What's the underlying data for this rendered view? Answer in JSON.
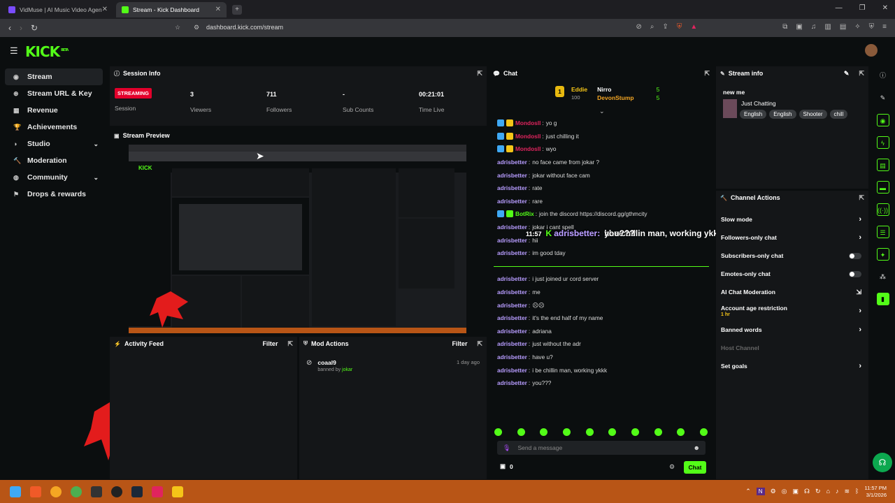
{
  "browser": {
    "tabs": [
      {
        "label": "VidMuse | AI Music Video Agent fo",
        "active": false
      },
      {
        "label": "Stream - Kick Dashboard",
        "active": true
      }
    ],
    "url": "dashboard.kick.com/stream"
  },
  "app": {
    "logo": "KICK",
    "logo_badge": "BETA"
  },
  "sidebar": {
    "items": [
      {
        "label": "Stream",
        "icon": "stream-icon",
        "active": true
      },
      {
        "label": "Stream URL & Key",
        "icon": "key-icon"
      },
      {
        "label": "Revenue",
        "icon": "revenue-icon"
      },
      {
        "label": "Achievements",
        "icon": "trophy-icon"
      },
      {
        "label": "Studio",
        "icon": "studio-icon",
        "expandable": true
      },
      {
        "label": "Moderation",
        "icon": "moderation-icon"
      },
      {
        "label": "Community",
        "icon": "community-icon",
        "expandable": true
      },
      {
        "label": "Drops & rewards",
        "icon": "gift-icon"
      }
    ]
  },
  "session_info": {
    "title": "Session Info",
    "status": "STREAMING",
    "status_label": "Session",
    "viewers": "3",
    "viewers_label": "Viewers",
    "followers": "711",
    "followers_label": "Followers",
    "subs": "-",
    "subs_label": "Sub Counts",
    "time": "00:21:01",
    "time_label": "Time Live"
  },
  "stream_preview": {
    "title": "Stream Preview"
  },
  "activity_feed": {
    "title": "Activity Feed",
    "filter": "Filter"
  },
  "mod_actions": {
    "title": "Mod Actions",
    "filter": "Filter",
    "entries": [
      {
        "user": "coaal9",
        "action": "banned by",
        "by": "jokar",
        "time": "1 day ago"
      }
    ]
  },
  "chat": {
    "title": "Chat",
    "leaderboard": [
      {
        "rank": "1",
        "name": "Eddie",
        "points": "100"
      },
      {
        "name": "Nirro",
        "points": "5"
      },
      {
        "name": "DevonStump",
        "points": "5"
      }
    ],
    "messages": [
      {
        "user": "Mondosll",
        "text": "yo g",
        "color": "#e0245e",
        "badges": true
      },
      {
        "user": "Mondosll",
        "text": "just chilling it",
        "color": "#e0245e",
        "badges": true
      },
      {
        "user": "Mondosll",
        "text": "wyo",
        "color": "#e0245e",
        "badges": true
      },
      {
        "user": "adrisbetter",
        "text": "no face came from jokar ?",
        "color": "#b79cff"
      },
      {
        "user": "adrisbetter",
        "text": "jokar without face cam",
        "color": "#b79cff"
      },
      {
        "user": "adrisbetter",
        "text": "rate",
        "color": "#b79cff"
      },
      {
        "user": "adrisbetter",
        "text": "rare",
        "color": "#b79cff"
      },
      {
        "user": "BotRix",
        "text": "join the discord https://discord.gg/gthmcity",
        "color": "#53fc18",
        "badges": true
      },
      {
        "user": "adrisbetter",
        "text": "jokar i cant spell",
        "color": "#b79cff"
      },
      {
        "user": "adrisbetter",
        "text": "hii",
        "color": "#b79cff"
      },
      {
        "user": "adrisbetter",
        "text": "im good tday",
        "color": "#b79cff"
      },
      {
        "user": "",
        "text": "",
        "color": "#b79cff"
      },
      {
        "user": "adrisbetter",
        "text": "i just joined ur cord server",
        "color": "#b79cff"
      },
      {
        "user": "adrisbetter",
        "text": "me",
        "color": "#b79cff"
      },
      {
        "user": "adrisbetter",
        "text": "☹☹",
        "color": "#b79cff"
      },
      {
        "user": "adrisbetter",
        "text": "it's the end half of my name",
        "color": "#b79cff"
      },
      {
        "user": "adrisbetter",
        "text": "adriana",
        "color": "#b79cff"
      },
      {
        "user": "adrisbetter",
        "text": "just without the adr",
        "color": "#b79cff"
      },
      {
        "user": "adrisbetter",
        "text": "have u?",
        "color": "#b79cff"
      },
      {
        "user": "adrisbetter",
        "text": "i be chillin man, working ykkk",
        "color": "#b79cff"
      },
      {
        "user": "adrisbetter",
        "text": "you???",
        "color": "#b79cff"
      }
    ],
    "overlay": [
      {
        "time": "11:57",
        "user": "adrisbetter:",
        "text": "have u?"
      },
      {
        "time": "11:57",
        "user": "adrisbetter:",
        "text": "i be chillin man, working ykkk"
      },
      {
        "time": "11:57",
        "user": "adrisbetter:",
        "text": "you???"
      }
    ],
    "input_placeholder": "Send a message",
    "count": "0",
    "send_label": "Chat"
  },
  "stream_info": {
    "title": "Stream info",
    "stream_title": "new me",
    "category": "Just Chatting",
    "tags": [
      "English",
      "English",
      "Shooter",
      "chill"
    ]
  },
  "channel_actions": {
    "title": "Channel Actions",
    "items": [
      {
        "label": "Slow mode",
        "control": "chevron"
      },
      {
        "label": "Followers-only chat",
        "control": "chevron"
      },
      {
        "label": "Subscribers-only chat",
        "control": "toggle"
      },
      {
        "label": "Emotes-only chat",
        "control": "toggle"
      },
      {
        "label": "AI Chat Moderation",
        "control": "external"
      },
      {
        "label": "Account age restriction",
        "sub": "1 hr",
        "control": "chevron"
      },
      {
        "label": "Banned words",
        "control": "chevron"
      },
      {
        "label": "Host Channel",
        "control": "none",
        "disabled": true
      },
      {
        "label": "Set goals",
        "control": "chevron"
      }
    ]
  },
  "taskbar": {
    "time": "11:57 PM",
    "date": "3/1/2026"
  },
  "colors": {
    "accent": "#53fc18",
    "live": "#e3002b",
    "panel": "#141618",
    "taskbar": "#b85516"
  }
}
